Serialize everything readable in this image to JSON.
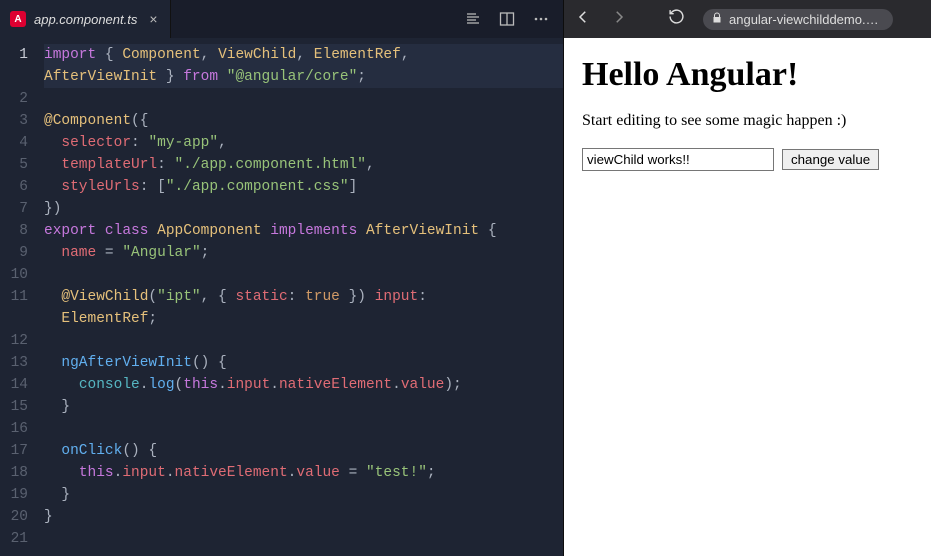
{
  "editor": {
    "tab": {
      "filename": "app.component.ts",
      "iconLetter": "A"
    },
    "actions": {
      "format": "format-icon",
      "split": "split-editor-icon",
      "more": "more-icon"
    },
    "lines": [
      {
        "n": 1,
        "current": true,
        "html": "<span class='kw'>import</span> <span class='pun'>{</span> <span class='cls'>Component</span><span class='pun'>,</span> <span class='cls'>ViewChild</span><span class='pun'>,</span> <span class='cls'>ElementRef</span><span class='pun'>,</span>"
      },
      {
        "n": "",
        "current": true,
        "html": "<span class='cls'>AfterViewInit</span> <span class='pun'>}</span> <span class='kw'>from</span> <span class='str'>\"@angular/core\"</span><span class='pun'>;</span>"
      },
      {
        "n": 2,
        "current": false,
        "html": ""
      },
      {
        "n": 3,
        "current": false,
        "html": "<span class='dec'>@Component</span><span class='pun'>({</span>"
      },
      {
        "n": 4,
        "current": false,
        "html": "  <span class='prop'>selector</span><span class='pun'>:</span> <span class='str'>\"my-app\"</span><span class='pun'>,</span>"
      },
      {
        "n": 5,
        "current": false,
        "html": "  <span class='prop'>templateUrl</span><span class='pun'>:</span> <span class='str'>\"./app.component.html\"</span><span class='pun'>,</span>"
      },
      {
        "n": 6,
        "current": false,
        "html": "  <span class='prop'>styleUrls</span><span class='pun'>:</span> <span class='pun'>[</span><span class='str'>\"./app.component.css\"</span><span class='pun'>]</span>"
      },
      {
        "n": 7,
        "current": false,
        "html": "<span class='pun'>})</span>"
      },
      {
        "n": 8,
        "current": false,
        "html": "<span class='kw'>export</span> <span class='kw'>class</span> <span class='cls'>AppComponent</span> <span class='kw'>implements</span> <span class='cls'>AfterViewInit</span> <span class='pun'>{</span>"
      },
      {
        "n": 9,
        "current": false,
        "html": "  <span class='prop'>name</span> <span class='pun'>=</span> <span class='str'>\"Angular\"</span><span class='pun'>;</span>"
      },
      {
        "n": 10,
        "current": false,
        "html": ""
      },
      {
        "n": 11,
        "current": false,
        "html": "  <span class='dec'>@ViewChild</span><span class='pun'>(</span><span class='str'>\"ipt\"</span><span class='pun'>,</span> <span class='pun'>{</span> <span class='prop'>static</span><span class='pun'>:</span> <span class='bool'>true</span> <span class='pun'>})</span> <span class='prop'>input</span><span class='pun'>:</span>"
      },
      {
        "n": "",
        "current": false,
        "html": "  <span class='cls'>ElementRef</span><span class='pun'>;</span>"
      },
      {
        "n": 12,
        "current": false,
        "html": ""
      },
      {
        "n": 13,
        "current": false,
        "html": "  <span class='fn'>ngAfterViewInit</span><span class='pun'>() {</span>"
      },
      {
        "n": 14,
        "current": false,
        "html": "    <span class='obj'>console</span><span class='pun'>.</span><span class='fn'>log</span><span class='pun'>(</span><span class='kw'>this</span><span class='pun'>.</span><span class='prop'>input</span><span class='pun'>.</span><span class='prop'>nativeElement</span><span class='pun'>.</span><span class='prop'>value</span><span class='pun'>);</span>"
      },
      {
        "n": 15,
        "current": false,
        "html": "  <span class='pun'>}</span>"
      },
      {
        "n": 16,
        "current": false,
        "html": ""
      },
      {
        "n": 17,
        "current": false,
        "html": "  <span class='fn'>onClick</span><span class='pun'>() {</span>"
      },
      {
        "n": 18,
        "current": false,
        "html": "    <span class='kw'>this</span><span class='pun'>.</span><span class='prop'>input</span><span class='pun'>.</span><span class='prop'>nativeElement</span><span class='pun'>.</span><span class='prop'>value</span> <span class='pun'>=</span> <span class='str'>\"test!\"</span><span class='pun'>;</span>"
      },
      {
        "n": 19,
        "current": false,
        "html": "  <span class='pun'>}</span>"
      },
      {
        "n": 20,
        "current": false,
        "html": "<span class='pun'>}</span>"
      },
      {
        "n": 21,
        "current": false,
        "html": ""
      }
    ]
  },
  "browser": {
    "url": "angular-viewchilddemo.s…"
  },
  "preview": {
    "heading": "Hello Angular!",
    "subtext": "Start editing to see some magic happen :)",
    "inputValue": "viewChild works!!",
    "buttonLabel": "change value"
  }
}
